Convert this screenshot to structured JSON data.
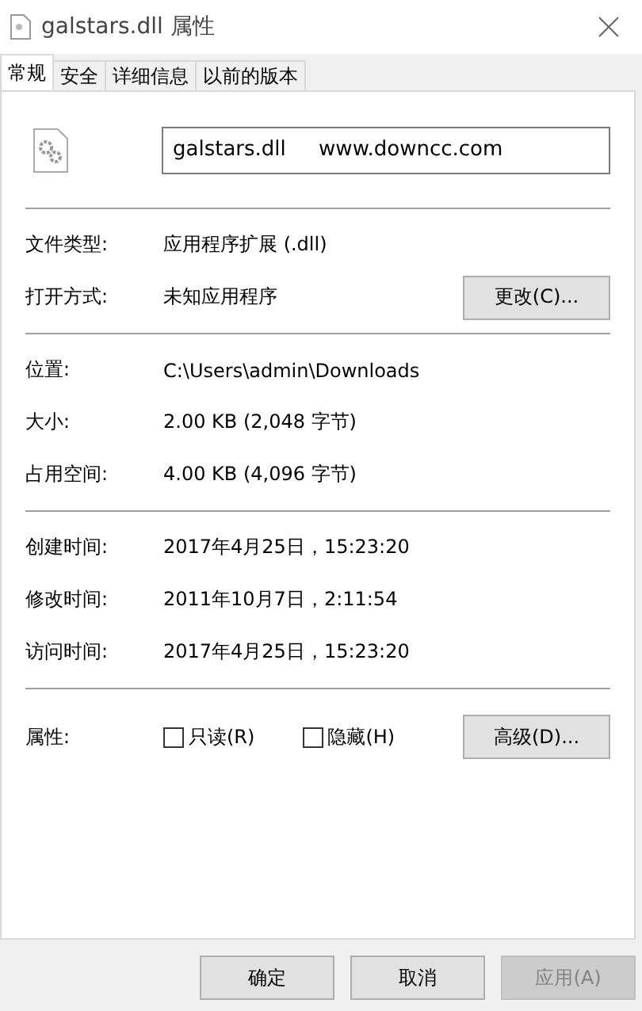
{
  "window": {
    "title": "galstars.dll 属性"
  },
  "tabs": [
    {
      "label": "常规",
      "selected": true
    },
    {
      "label": "安全",
      "selected": false
    },
    {
      "label": "详细信息",
      "selected": false
    },
    {
      "label": "以前的版本",
      "selected": false
    }
  ],
  "file_name": {
    "value": "galstars.dll     www.downcc.com"
  },
  "sections": [
    [
      {
        "label": "文件类型:",
        "value": "应用程序扩展 (.dll)"
      },
      {
        "label": "打开方式:",
        "value": "未知应用程序",
        "button": "更改(C)..."
      }
    ],
    [
      {
        "label": "位置:",
        "value": "C:\\Users\\admin\\Downloads"
      },
      {
        "label": "大小:",
        "value": "2.00 KB (2,048 字节)"
      },
      {
        "label": "占用空间:",
        "value": "4.00 KB (4,096 字节)"
      }
    ],
    [
      {
        "label": "创建时间:",
        "value": "2017年4月25日，15:23:20"
      },
      {
        "label": "修改时间:",
        "value": "2011年10月7日，2:11:54"
      },
      {
        "label": "访问时间:",
        "value": "2017年4月25日，15:23:20"
      }
    ]
  ],
  "attributes": {
    "label": "属性:",
    "checkboxes": [
      {
        "label": "只读(R)",
        "checked": false
      },
      {
        "label": "隐藏(H)",
        "checked": false
      }
    ],
    "button": "高级(D)..."
  },
  "buttons": [
    {
      "label": "确定",
      "disabled": false
    },
    {
      "label": "取消",
      "disabled": false
    },
    {
      "label": "应用(A)",
      "disabled": true
    }
  ]
}
